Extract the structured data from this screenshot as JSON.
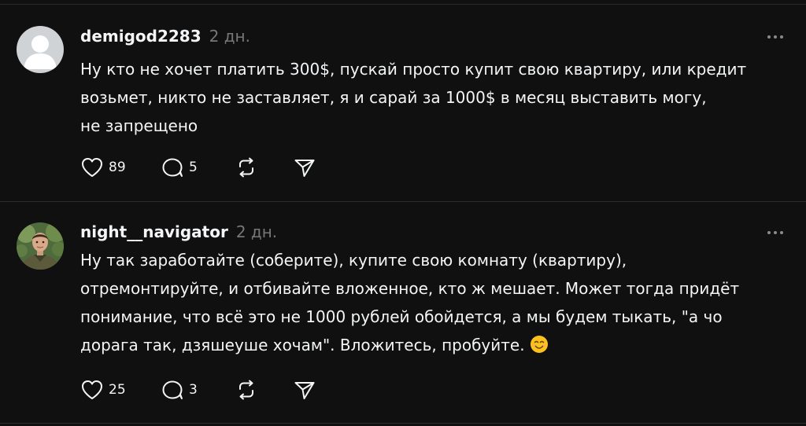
{
  "colors": {
    "background": "#101010",
    "text": "#f3f5f7",
    "muted": "#777777",
    "divider": "#2c2c2c"
  },
  "posts": [
    {
      "username": "demigod2283",
      "time": "2 дн.",
      "avatar": "default-avatar",
      "text_lines": [
        "Ну кто не хочет платить 300$, пускай просто купит свою квартиру, или кредит",
        "возьмет, никто не заставляет, я и сарай за 1000$ в месяц выставить могу,",
        "не запрещено"
      ],
      "likes": "89",
      "replies": "5"
    },
    {
      "username": "night__navigator",
      "time": "2 дн.",
      "avatar": "user-photo",
      "text_lines": [
        "Ну так заработайте (соберите), купите свою комнату (квартиру),",
        "отремонтируйте, и отбивайте вложенное, кто ж мешает. Может тогда придёт",
        "понимание, что всё это не 1000 рублей обойдется, а мы будем тыкать, \"а чо",
        "дорага так, дзяшеуше хочам\". Вложитесь, пробуйте."
      ],
      "emoji": "smiling-face-emoji",
      "likes": "25",
      "replies": "3"
    }
  ]
}
